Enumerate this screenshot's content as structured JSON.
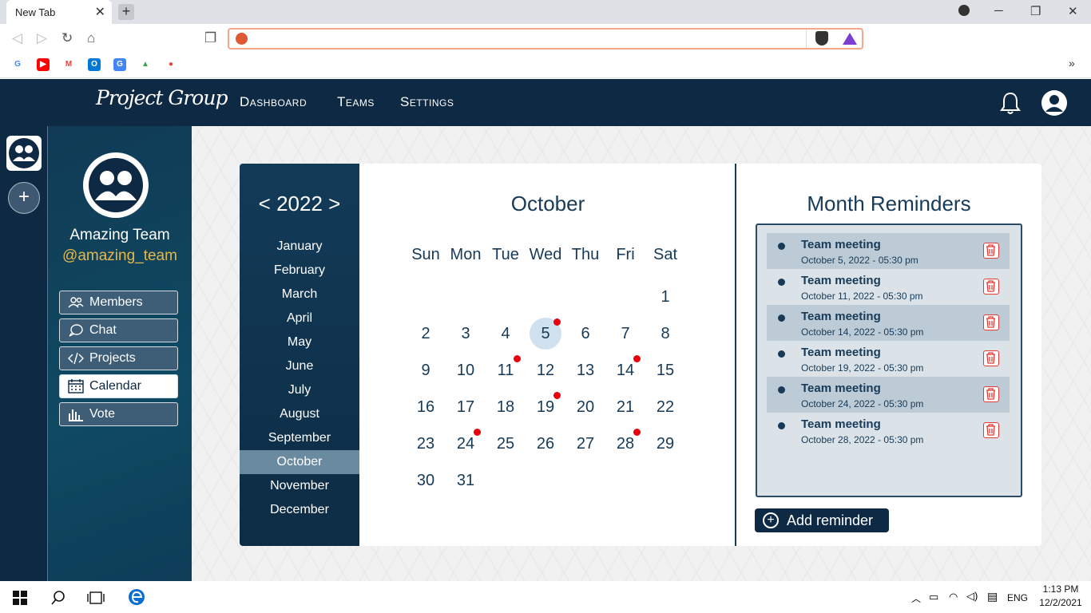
{
  "browser": {
    "tab_title": "New Tab",
    "tab_close": "✕",
    "new_tab": "+",
    "address_value": "",
    "bookmarks": [
      {
        "name": "google",
        "label": "G",
        "color": "#4285f4"
      },
      {
        "name": "youtube",
        "label": "▶",
        "color": "#ff0000"
      },
      {
        "name": "gmail",
        "label": "M",
        "color": "#ea4335"
      },
      {
        "name": "outlook",
        "label": "O",
        "color": "#0078d4"
      },
      {
        "name": "translate",
        "label": "G",
        "color": "#4285f4"
      },
      {
        "name": "drive",
        "label": "▲",
        "color": "#34a853"
      },
      {
        "name": "maps",
        "label": "●",
        "color": "#ea4335"
      }
    ],
    "more_bookmarks": "»"
  },
  "app": {
    "logo": "Project Group",
    "nav": [
      "Dashboard",
      "Teams",
      "Settings"
    ]
  },
  "team": {
    "name": "Amazing Team",
    "handle": "@amazing_team",
    "menu": [
      {
        "label": "Members",
        "icon": "members-icon"
      },
      {
        "label": "Chat",
        "icon": "chat-icon"
      },
      {
        "label": "Projects",
        "icon": "code-icon"
      },
      {
        "label": "Calendar",
        "icon": "calendar-icon",
        "active": true
      },
      {
        "label": "Vote",
        "icon": "chart-icon"
      }
    ]
  },
  "calendar": {
    "year_display": "< 2022 >",
    "months": [
      "January",
      "February",
      "March",
      "April",
      "May",
      "June",
      "July",
      "August",
      "September",
      "October",
      "November",
      "December"
    ],
    "selected_month": "October",
    "title": "October",
    "weekdays": [
      "Sun",
      "Mon",
      "Tue",
      "Wed",
      "Thu",
      "Fri",
      "Sat"
    ],
    "first_weekday": 6,
    "days_in_month": 31,
    "today": 5,
    "event_days": [
      5,
      11,
      14,
      19,
      24,
      28
    ]
  },
  "reminders": {
    "title": "Month Reminders",
    "items": [
      {
        "title": "Team meeting",
        "date": "October 5, 2022 - 05:30 pm"
      },
      {
        "title": "Team meeting",
        "date": "October 11, 2022 - 05:30 pm"
      },
      {
        "title": "Team meeting",
        "date": "October 14, 2022 - 05:30 pm"
      },
      {
        "title": "Team meeting",
        "date": "October 19, 2022 - 05:30 pm"
      },
      {
        "title": "Team meeting",
        "date": "October 24, 2022 - 05:30 pm"
      },
      {
        "title": "Team meeting",
        "date": "October 28, 2022 - 05:30 pm"
      }
    ],
    "add_label": "Add reminder"
  },
  "taskbar": {
    "language": "ENG",
    "time": "1:13 PM",
    "date": "12/2/2021"
  }
}
